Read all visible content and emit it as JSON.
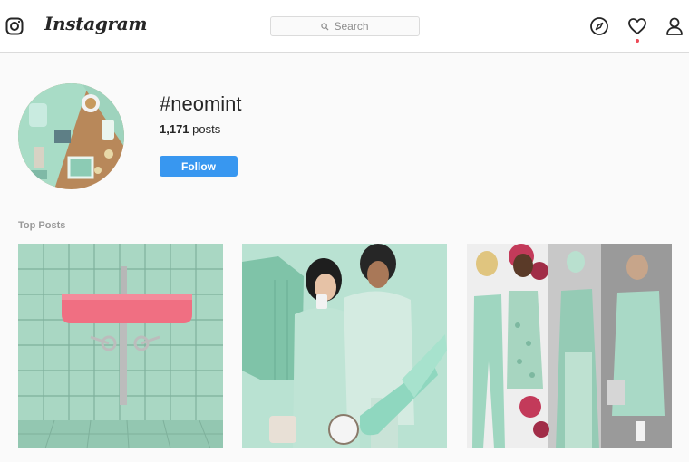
{
  "navbar": {
    "logo_icon": "instagram-glyph-icon",
    "wordmark": "Instagram",
    "search": {
      "placeholder": "Search",
      "icon": "search-icon"
    },
    "icons": [
      "compass-icon",
      "heart-icon",
      "person-icon"
    ],
    "notification_dot_color": "#ed4956"
  },
  "profile": {
    "hashtag": "#neomint",
    "post_count": "1,171",
    "post_count_label": " posts",
    "follow_label": "Follow",
    "follow_color": "#3897f0"
  },
  "top_posts": {
    "title": "Top Posts",
    "items": [
      {
        "subject": "pink-sink-mint-tiles"
      },
      {
        "subject": "mint-fashion-collage"
      },
      {
        "subject": "mint-outfits-runway"
      }
    ]
  },
  "colors": {
    "mint": "#a8dcc6",
    "background": "#fafafa",
    "border": "#dbdbdb"
  }
}
